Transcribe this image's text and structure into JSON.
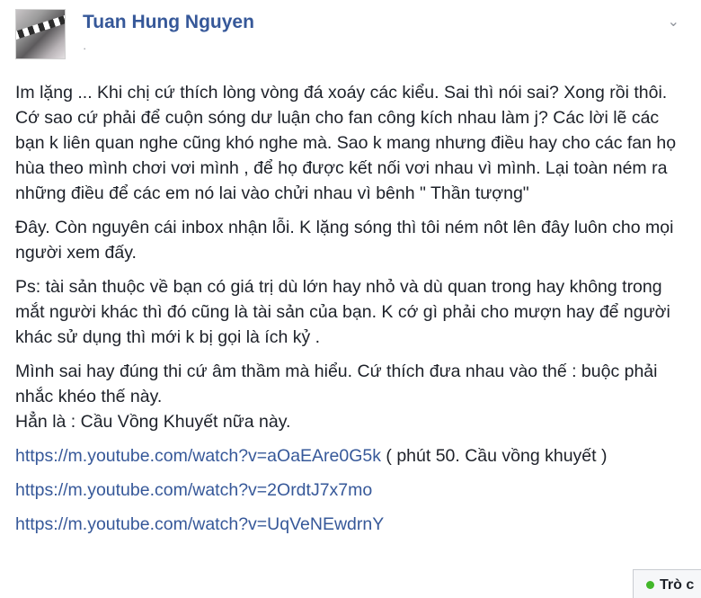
{
  "author": {
    "name": "Tuan Hung Nguyen",
    "meta": "·"
  },
  "post": {
    "paragraphs": [
      "Im lặng ... Khi chị cứ thích lòng vòng đá xoáy các kiểu. Sai thì nói sai? Xong rồi thôi.",
      "Cớ sao cứ phải để cuộn sóng dư luận cho fan công kích nhau làm j? Các lời lẽ các bạn k liên quan nghe cũng khó nghe mà. Sao k mang nhưng điều hay cho các fan họ hùa theo mình chơi vơi mình , để họ được kết nối vơi nhau vì mình. Lại toàn ném ra những điều để các em nó lai vào chửi nhau vì bênh \" Thần tượng\"",
      "Đây. Còn nguyên cái inbox nhận lỗi. K lặng sóng thì tôi ném nôt lên đây luôn cho mọi người xem đấy.",
      "Ps: tài sản thuộc về bạn có giá trị dù lớn hay nhỏ và dù quan trong hay không trong mắt người khác thì đó cũng là tài sản của bạn. K cớ gì phải cho mượn hay để người khác sử dụng thì mới k bị gọi là ích kỷ .",
      "Mình sai hay đúng thi cứ âm thầm mà hiểu. Cứ thích đưa nhau vào thế : buộc phải nhắc khéo thế này.",
      "Hẳn là : Cầu Vồng Khuyết nữa này."
    ],
    "links": [
      {
        "url": "https://m.youtube.com/watch?v=aOaEAre0G5k",
        "note": " ( phút 50. Cầu vồng khuyết )"
      },
      {
        "url": "https://m.youtube.com/watch?v=2OrdtJ7x7mo",
        "note": ""
      },
      {
        "url": "https://m.youtube.com/watch?v=UqVeNEwdrnY",
        "note": ""
      }
    ]
  },
  "chat": {
    "label": "Trò c"
  },
  "icons": {
    "menu": "chevron-down-icon",
    "online": "online-dot-icon"
  },
  "colors": {
    "link": "#365899",
    "text": "#1d2129",
    "online": "#42b72a"
  }
}
